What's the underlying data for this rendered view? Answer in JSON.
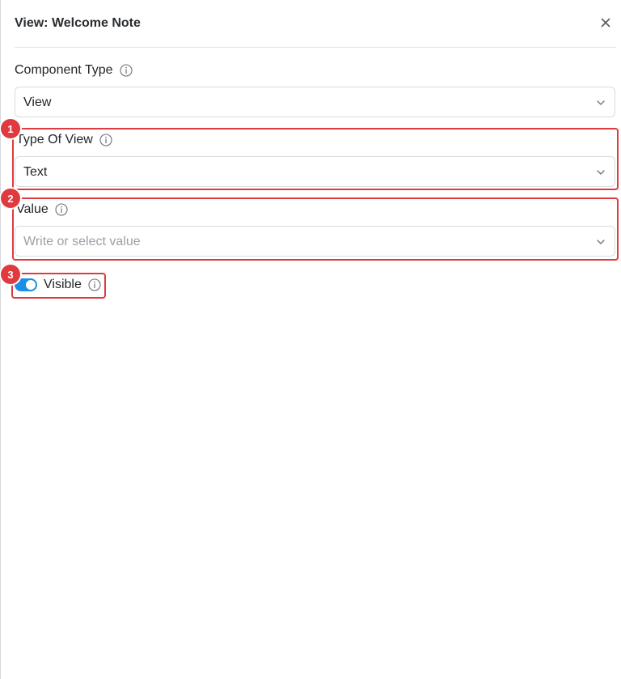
{
  "panel": {
    "title": "View: Welcome Note"
  },
  "fields": {
    "component_type": {
      "label": "Component Type",
      "value": "View"
    },
    "type_of_view": {
      "label": "Type Of View",
      "value": "Text"
    },
    "value": {
      "label": "Value",
      "placeholder": "Write or select value"
    },
    "visible": {
      "label": "Visible",
      "checked": true
    }
  },
  "badges": [
    "1",
    "2",
    "3"
  ],
  "icons": {
    "close": "close-icon",
    "info": "info-icon",
    "chevron": "chevron-down-icon"
  },
  "colors": {
    "highlight": "#e03a3e",
    "toggle_on": "#1a8fe3",
    "placeholder": "#9aa0a6"
  }
}
